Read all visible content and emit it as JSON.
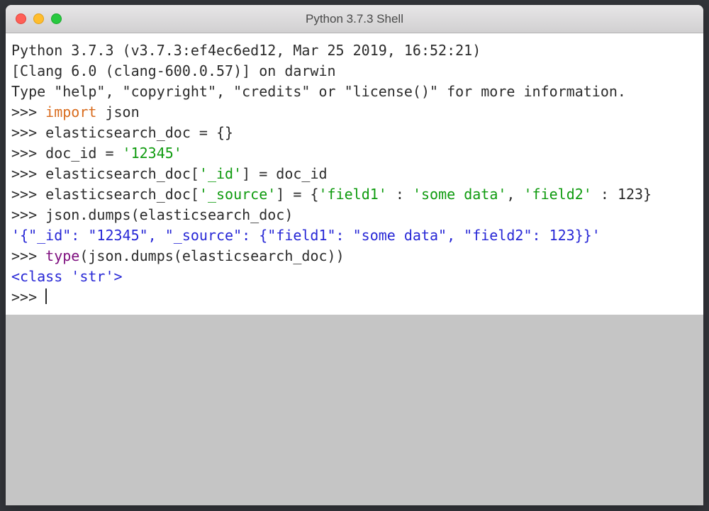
{
  "window": {
    "title": "Python 3.7.3 Shell"
  },
  "banner": {
    "line1": "Python 3.7.3 (v3.7.3:ef4ec6ed12, Mar 25 2019, 16:52:21) ",
    "line2": "[Clang 6.0 (clang-600.0.57)] on darwin",
    "line3": "Type \"help\", \"copyright\", \"credits\" or \"license()\" for more information."
  },
  "lines": {
    "l1": {
      "prompt": ">>> ",
      "kw": "import",
      "rest": " json"
    },
    "l2": {
      "prompt": ">>> ",
      "text": "elasticsearch_doc = {}"
    },
    "l3": {
      "prompt": ">>> ",
      "a": "doc_id = ",
      "str": "'12345'"
    },
    "l4": {
      "prompt": ">>> ",
      "a": "elasticsearch_doc[",
      "s1": "'_id'",
      "b": "] = doc_id"
    },
    "l5": {
      "prompt": ">>> ",
      "a": "elasticsearch_doc[",
      "s1": "'_source'",
      "b": "] = {",
      "s2": "'field1'",
      "c": " : ",
      "s3": "'some data'",
      "d": ", ",
      "s4": "'field2'",
      "e": " : 123}"
    },
    "l6": {
      "prompt": ">>> ",
      "text": "json.dumps(elasticsearch_doc)"
    },
    "l7": {
      "out": "'{\"_id\": \"12345\", \"_source\": {\"field1\": \"some data\", \"field2\": 123}}'"
    },
    "l8": {
      "prompt": ">>> ",
      "builtin": "type",
      "rest": "(json.dumps(elasticsearch_doc))"
    },
    "l9": {
      "out": "<class 'str'>"
    },
    "l10": {
      "prompt": ">>> "
    }
  }
}
